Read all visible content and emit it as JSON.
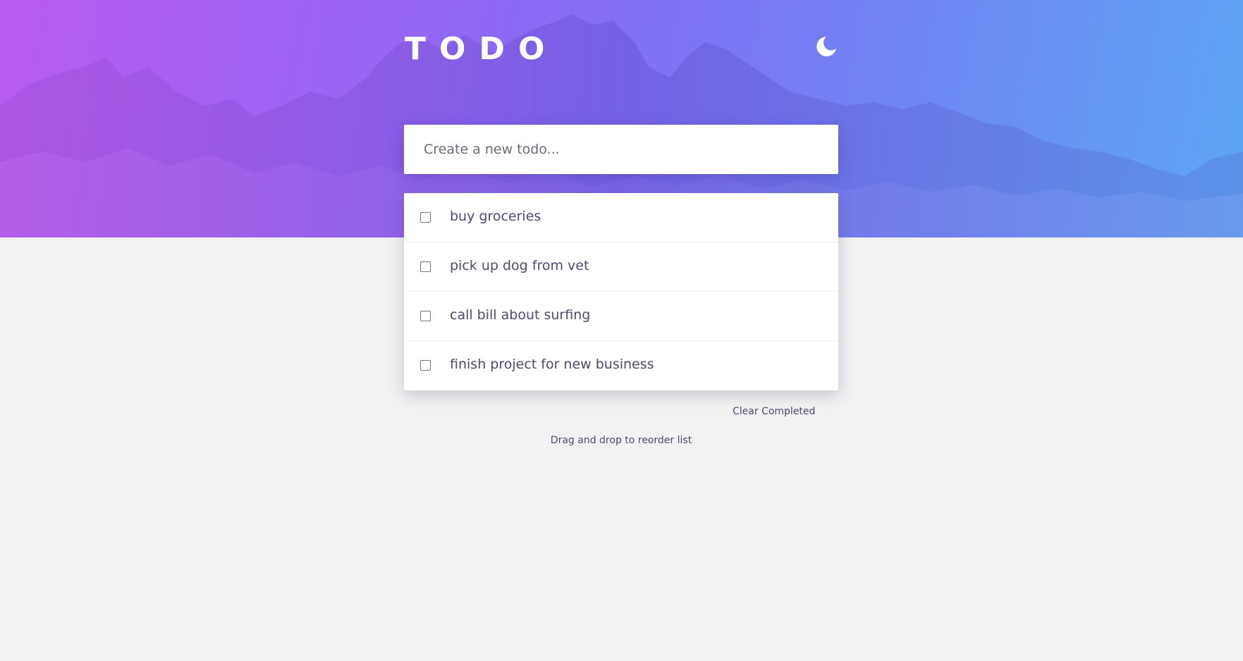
{
  "app": {
    "title": "TODO",
    "theme_toggle_icon": "moon-icon"
  },
  "new_todo": {
    "placeholder": "Create a new todo..."
  },
  "todos": [
    {
      "text": "buy groceries",
      "completed": false
    },
    {
      "text": "pick up dog from vet",
      "completed": false
    },
    {
      "text": "call bill about surfing",
      "completed": false
    },
    {
      "text": "finish project for new business",
      "completed": false
    }
  ],
  "footer": {
    "clear_completed_label": "Clear Completed",
    "hint": "Drag and drop to reorder list"
  },
  "colors": {
    "background": "#f2f2f2",
    "text": "#494c6b",
    "hero_gradient_start": "#b65cf0",
    "hero_gradient_end": "#5ea8f4"
  }
}
